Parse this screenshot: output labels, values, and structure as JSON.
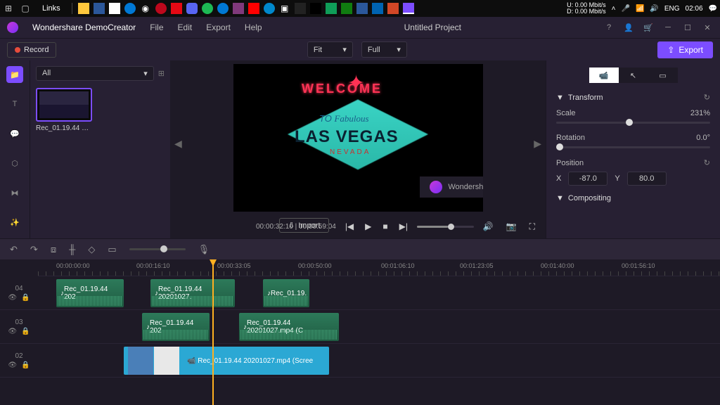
{
  "taskbar": {
    "links": "Links",
    "net_up": "0.00 Mbit/s",
    "net_down": "0.00 Mbit/s",
    "lang": "ENG",
    "time": "02:06"
  },
  "app": {
    "name": "Wondershare DemoCreator",
    "project": "Untitled Project"
  },
  "menu": {
    "file": "File",
    "edit": "Edit",
    "export": "Export",
    "help": "Help"
  },
  "subbar": {
    "record": "Record",
    "fit": "Fit",
    "quality": "Full",
    "export": "Export"
  },
  "media": {
    "filter": "All",
    "thumb1": "Rec_01.19.44 2020...",
    "import": "Import"
  },
  "preview": {
    "welcome": "WELCOME",
    "to": "TO",
    "fabulous": "Fabulous",
    "vegas": "LAS VEGAS",
    "nevada": "NEVADA",
    "watermark": "Wondershare DemoCre...",
    "time_current": "00:00:32:10",
    "time_total": "00:00:59:04"
  },
  "props": {
    "transform": "Transform",
    "scale": "Scale",
    "scale_val": "231%",
    "rotation": "Rotation",
    "rotation_val": "0.0°",
    "position": "Position",
    "x_label": "X",
    "x_val": "-87.0",
    "y_label": "Y",
    "y_val": "80.0",
    "compositing": "Compositing"
  },
  "timeline": {
    "marks": [
      "00:00:00:00",
      "00:00:16:10",
      "00:00:33:05",
      "00:00:50:00",
      "00:01:06:10",
      "00:01:23:05",
      "00:01:40:00",
      "00:01:56:10"
    ],
    "tracks": {
      "t4": "04",
      "t3": "03",
      "t2": "02"
    },
    "clips": {
      "c1": "Rec_01.19.44 202",
      "c2": "Rec_01.19.44 20201027.",
      "c3": "Rec_01.19.",
      "c4": "Rec_01.19.44 202",
      "c5": "Rec_01.19.44 20201027.mp4 (C",
      "c6": "Rec_01.19.44 20201027.mp4 (Scree"
    }
  }
}
